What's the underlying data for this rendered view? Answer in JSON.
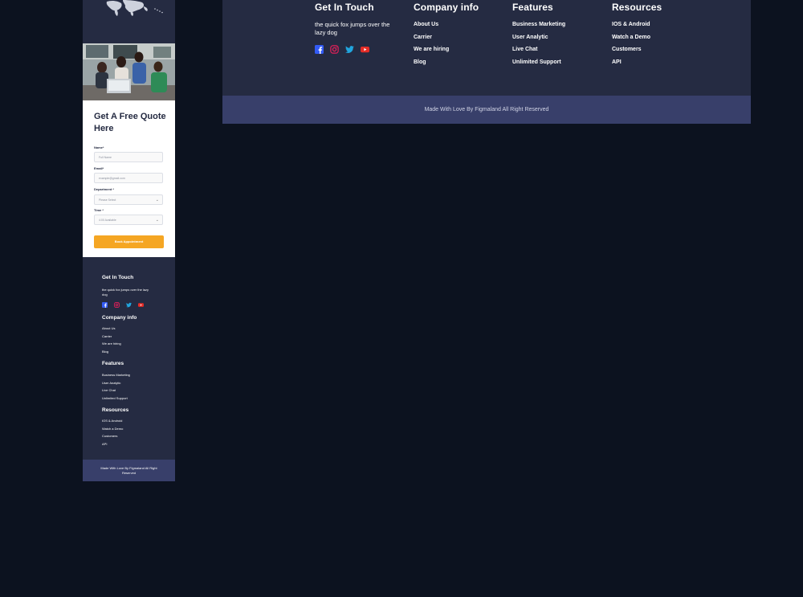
{
  "colors": {
    "page_bg": "#0c121f",
    "footer_bg": "#252b42",
    "bottom_bar_bg": "#383f6a",
    "button_bg": "#f5a623",
    "facebook": "#335bf5",
    "instagram": "#e51f5a",
    "twitter": "#21a6df",
    "youtube": "#e52d27"
  },
  "desktop_footer": {
    "get_in_touch": {
      "title": "Get In Touch",
      "text": "the quick fox jumps over the lazy dog",
      "socials": [
        "facebook-icon",
        "instagram-icon",
        "twitter-icon",
        "youtube-icon"
      ]
    },
    "company_info": {
      "title": "Company info",
      "links": [
        "About Us",
        "Carrier",
        "We are hiring",
        "Blog"
      ]
    },
    "features": {
      "title": "Features",
      "links": [
        "Business Marketing",
        "User Analytic",
        "Live Chat",
        "Unlimited Support"
      ]
    },
    "resources": {
      "title": "Resources",
      "links": [
        "IOS & Android",
        "Watch a Demo",
        "Customers",
        "API"
      ]
    },
    "copyright": "Made With Love By Figmaland All Right Reserved"
  },
  "mobile": {
    "quote_form": {
      "title": "Get A Free Quote Here",
      "name_label": "Name*",
      "name_placeholder": "Full Name",
      "email_label": "Email*",
      "email_placeholder": "example@gmail.com",
      "department_label": "Department *",
      "department_value": "Please Select",
      "time_label": "Time *",
      "time_value": "4:00 Available",
      "submit_label": "Book Appointment"
    },
    "footer": {
      "get_in_touch_title": "Get In Touch",
      "get_in_touch_text": "the quick fox jumps over the lazy dog",
      "company_info_title": "Company info",
      "company_info_links": [
        "About Us",
        "Carrier",
        "We are hiring",
        "Blog"
      ],
      "features_title": "Features",
      "features_links": [
        "Business Marketing",
        "User Analytic",
        "Live Chat",
        "Unlimited Support"
      ],
      "resources_title": "Resources",
      "resources_links": [
        "IOS & Android",
        "Watch a Demo",
        "Customers",
        "API"
      ],
      "copyright": "Made With Love By Figmaland All Right Reserved"
    }
  }
}
